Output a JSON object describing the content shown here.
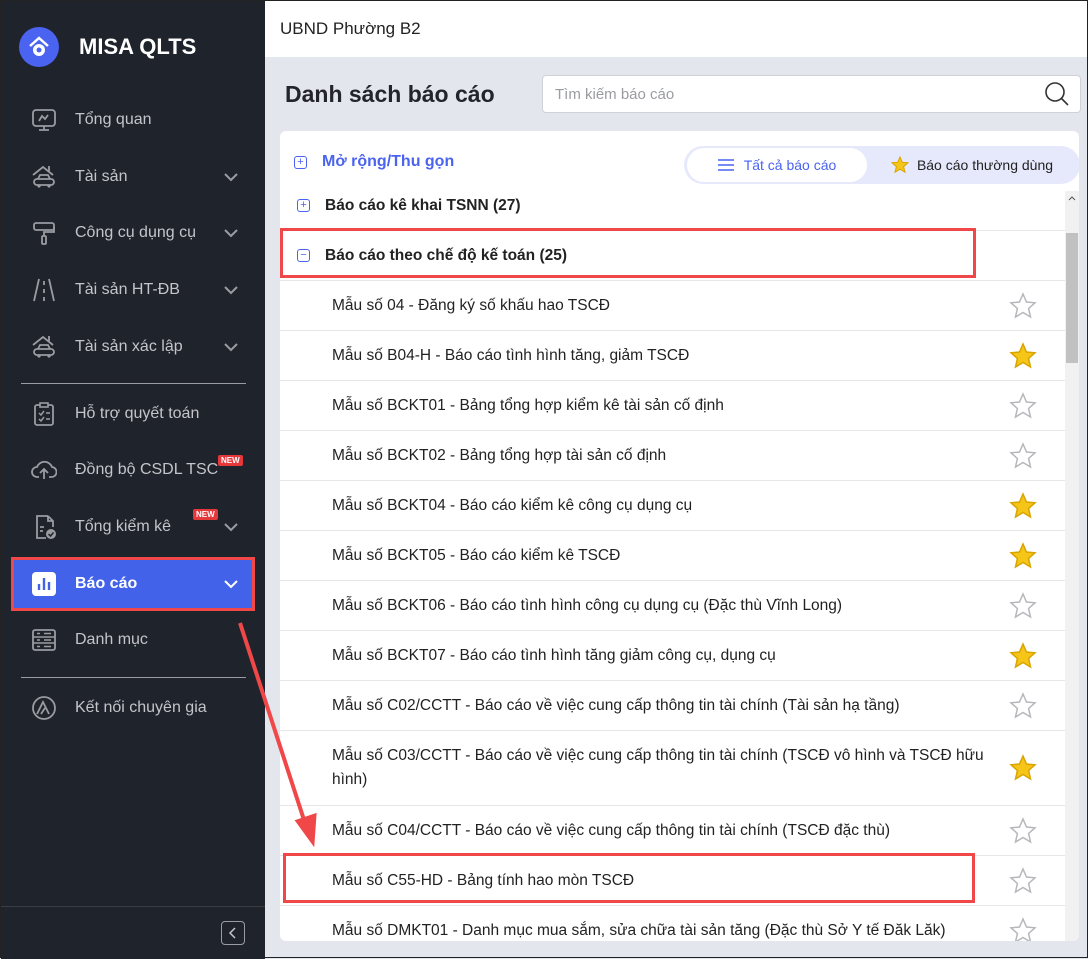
{
  "app": {
    "name": "MISA QLTS"
  },
  "topbar": {
    "org": "UBND Phường B2"
  },
  "sidebar": {
    "items": [
      {
        "label": "Tổng quan",
        "icon": "monitor-icon"
      },
      {
        "label": "Tài sản",
        "icon": "house-car-icon"
      },
      {
        "label": "Công cụ dụng cụ",
        "icon": "paint-roller-icon"
      },
      {
        "label": "Tài sản HT-ĐB",
        "icon": "road-icon"
      },
      {
        "label": "Tài sản xác lập",
        "icon": "house-car-icon"
      },
      {
        "label": "Hỗ trợ quyết toán",
        "icon": "clipboard-icon"
      },
      {
        "label": "Đồng bộ CSDL TSC",
        "icon": "cloud-upload-icon",
        "badge": "NEW"
      },
      {
        "label": "Tổng kiểm kê",
        "icon": "document-check-icon",
        "badge": "NEW"
      },
      {
        "label": "Báo cáo",
        "icon": "bar-chart-icon"
      },
      {
        "label": "Danh mục",
        "icon": "list-icon"
      },
      {
        "label": "Kết nối chuyên gia",
        "icon": "expert-icon"
      }
    ]
  },
  "main": {
    "title": "Danh sách báo cáo",
    "search_placeholder": "Tìm kiếm báo cáo",
    "expand_label": "Mở rộng/Thu gọn",
    "tabs": {
      "all": "Tất cả báo cáo",
      "favorite": "Báo cáo thường dùng"
    },
    "groups": [
      {
        "label": "Báo cáo kê khai TSNN (27)",
        "expanded": false
      },
      {
        "label": "Báo cáo theo chế độ kế toán (25)",
        "expanded": true
      }
    ],
    "reports": [
      {
        "label": "Mẫu số 04 - Đăng ký số khấu hao TSCĐ",
        "starred": false
      },
      {
        "label": "Mẫu số B04-H - Báo cáo tình hình tăng, giảm TSCĐ",
        "starred": true
      },
      {
        "label": "Mẫu số BCKT01 - Bảng tổng hợp kiểm kê tài sản cố định",
        "starred": false
      },
      {
        "label": "Mẫu số BCKT02 - Bảng tổng hợp tài sản cố định",
        "starred": false
      },
      {
        "label": "Mẫu số BCKT04 - Báo cáo kiểm kê công cụ dụng cụ",
        "starred": true
      },
      {
        "label": "Mẫu số BCKT05 - Báo cáo kiểm kê TSCĐ",
        "starred": true
      },
      {
        "label": "Mẫu số BCKT06 - Báo cáo tình hình công cụ dụng cụ (Đặc thù Vĩnh Long)",
        "starred": false
      },
      {
        "label": "Mẫu số BCKT07 - Báo cáo tình hình tăng giảm công cụ, dụng cụ",
        "starred": true
      },
      {
        "label": "Mẫu số C02/CCTT - Báo cáo về việc cung cấp thông tin tài chính (Tài sản hạ tầng)",
        "starred": false
      },
      {
        "label": "Mẫu số C03/CCTT - Báo cáo về việc cung cấp thông tin tài chính (TSCĐ vô hình và TSCĐ hữu hình)",
        "starred": true
      },
      {
        "label": "Mẫu số C04/CCTT - Báo cáo về việc cung cấp thông tin tài chính (TSCĐ đặc thù)",
        "starred": false
      },
      {
        "label": "Mẫu số C55-HD - Bảng tính hao mòn TSCĐ",
        "starred": false
      },
      {
        "label": "Mẫu số DMKT01 - Danh mục mua sắm, sửa chữa tài sản tăng (Đặc thù Sở Y tế Đăk Lăk)",
        "starred": false
      }
    ]
  },
  "colors": {
    "accent": "#4262ea",
    "sidebar": "#1f232b",
    "highlight": "#f04848",
    "star": "#f5c518"
  }
}
